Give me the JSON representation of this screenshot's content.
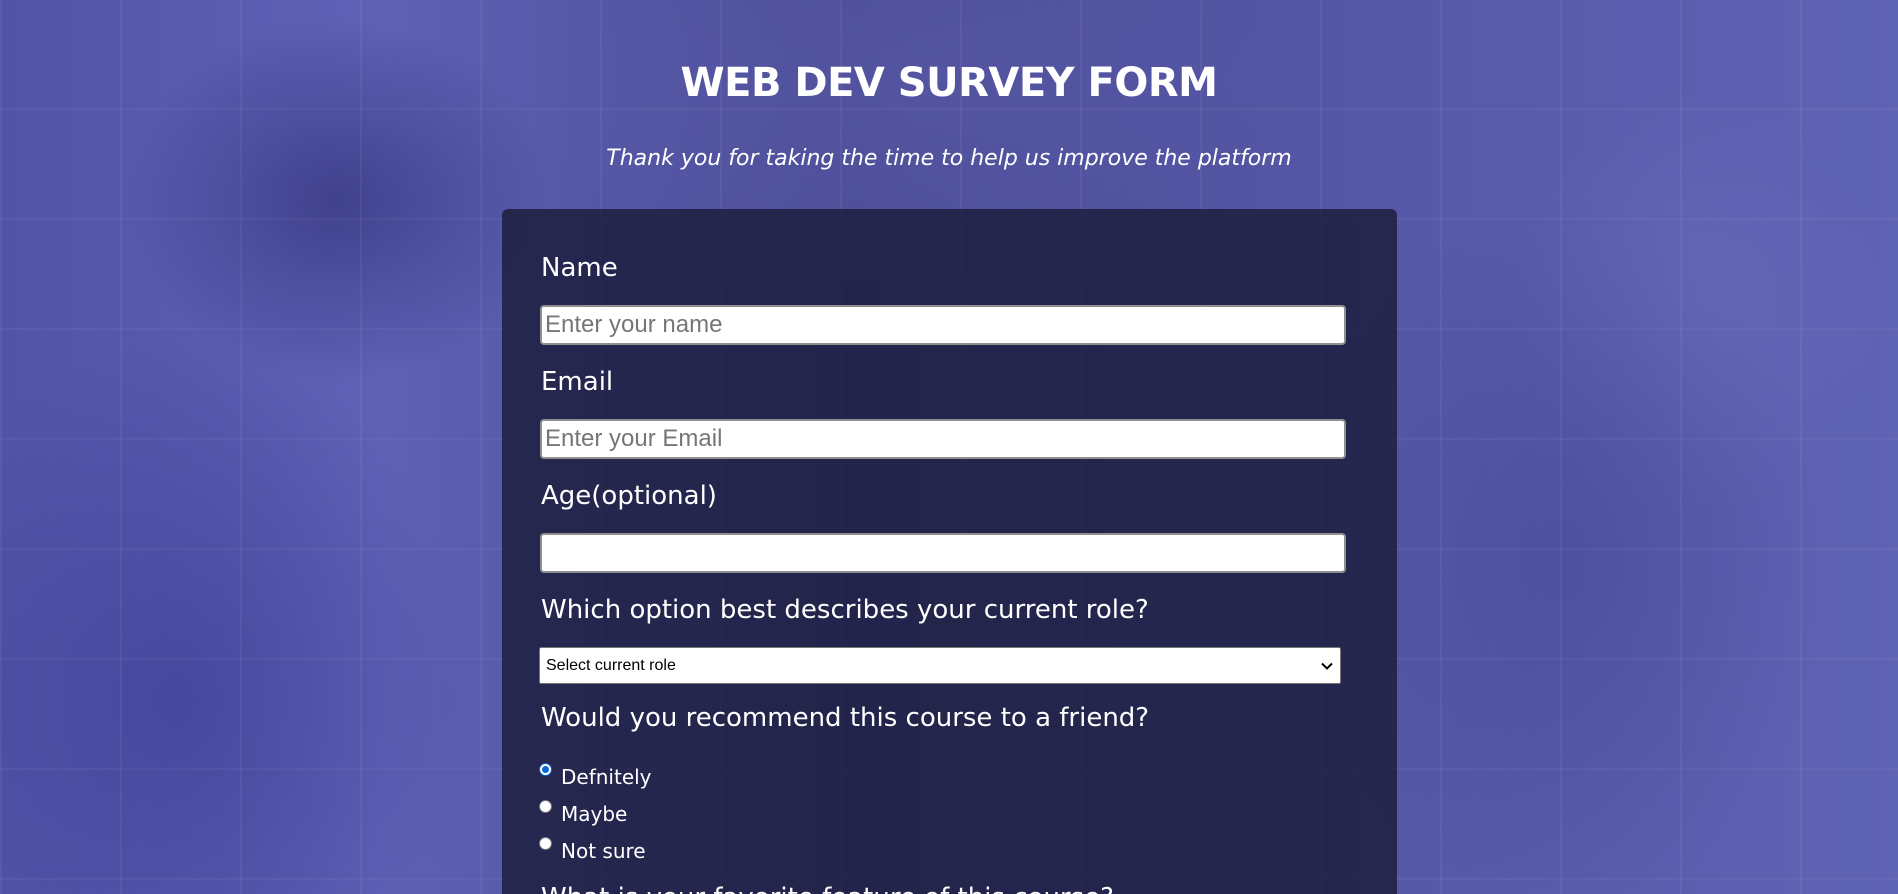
{
  "header": {
    "title": "WEB DEV SURVEY FORM",
    "description": "Thank you for taking the time to help us improve the platform"
  },
  "form": {
    "name": {
      "label": "Name",
      "placeholder": "Enter your name",
      "value": ""
    },
    "email": {
      "label": "Email",
      "placeholder": "Enter your Email",
      "value": ""
    },
    "age": {
      "label": "Age(optional)",
      "placeholder": "",
      "value": ""
    },
    "role": {
      "label": "Which option best describes your current role?",
      "selected": "Select current role"
    },
    "recommend": {
      "label": "Would you recommend this course to a friend?",
      "options": [
        {
          "label": "Defnitely",
          "checked": true
        },
        {
          "label": "Maybe",
          "checked": false
        },
        {
          "label": "Not sure",
          "checked": false
        }
      ]
    },
    "next_question_partial": "What is your favorite feature of this course?"
  },
  "colors": {
    "background": "#4b4d9e",
    "form_panel": "#1b1c3a",
    "text": "#ffffff",
    "radio_accent": "#0a66d6"
  },
  "icons": {
    "select_arrow": "chevron-down-icon"
  }
}
